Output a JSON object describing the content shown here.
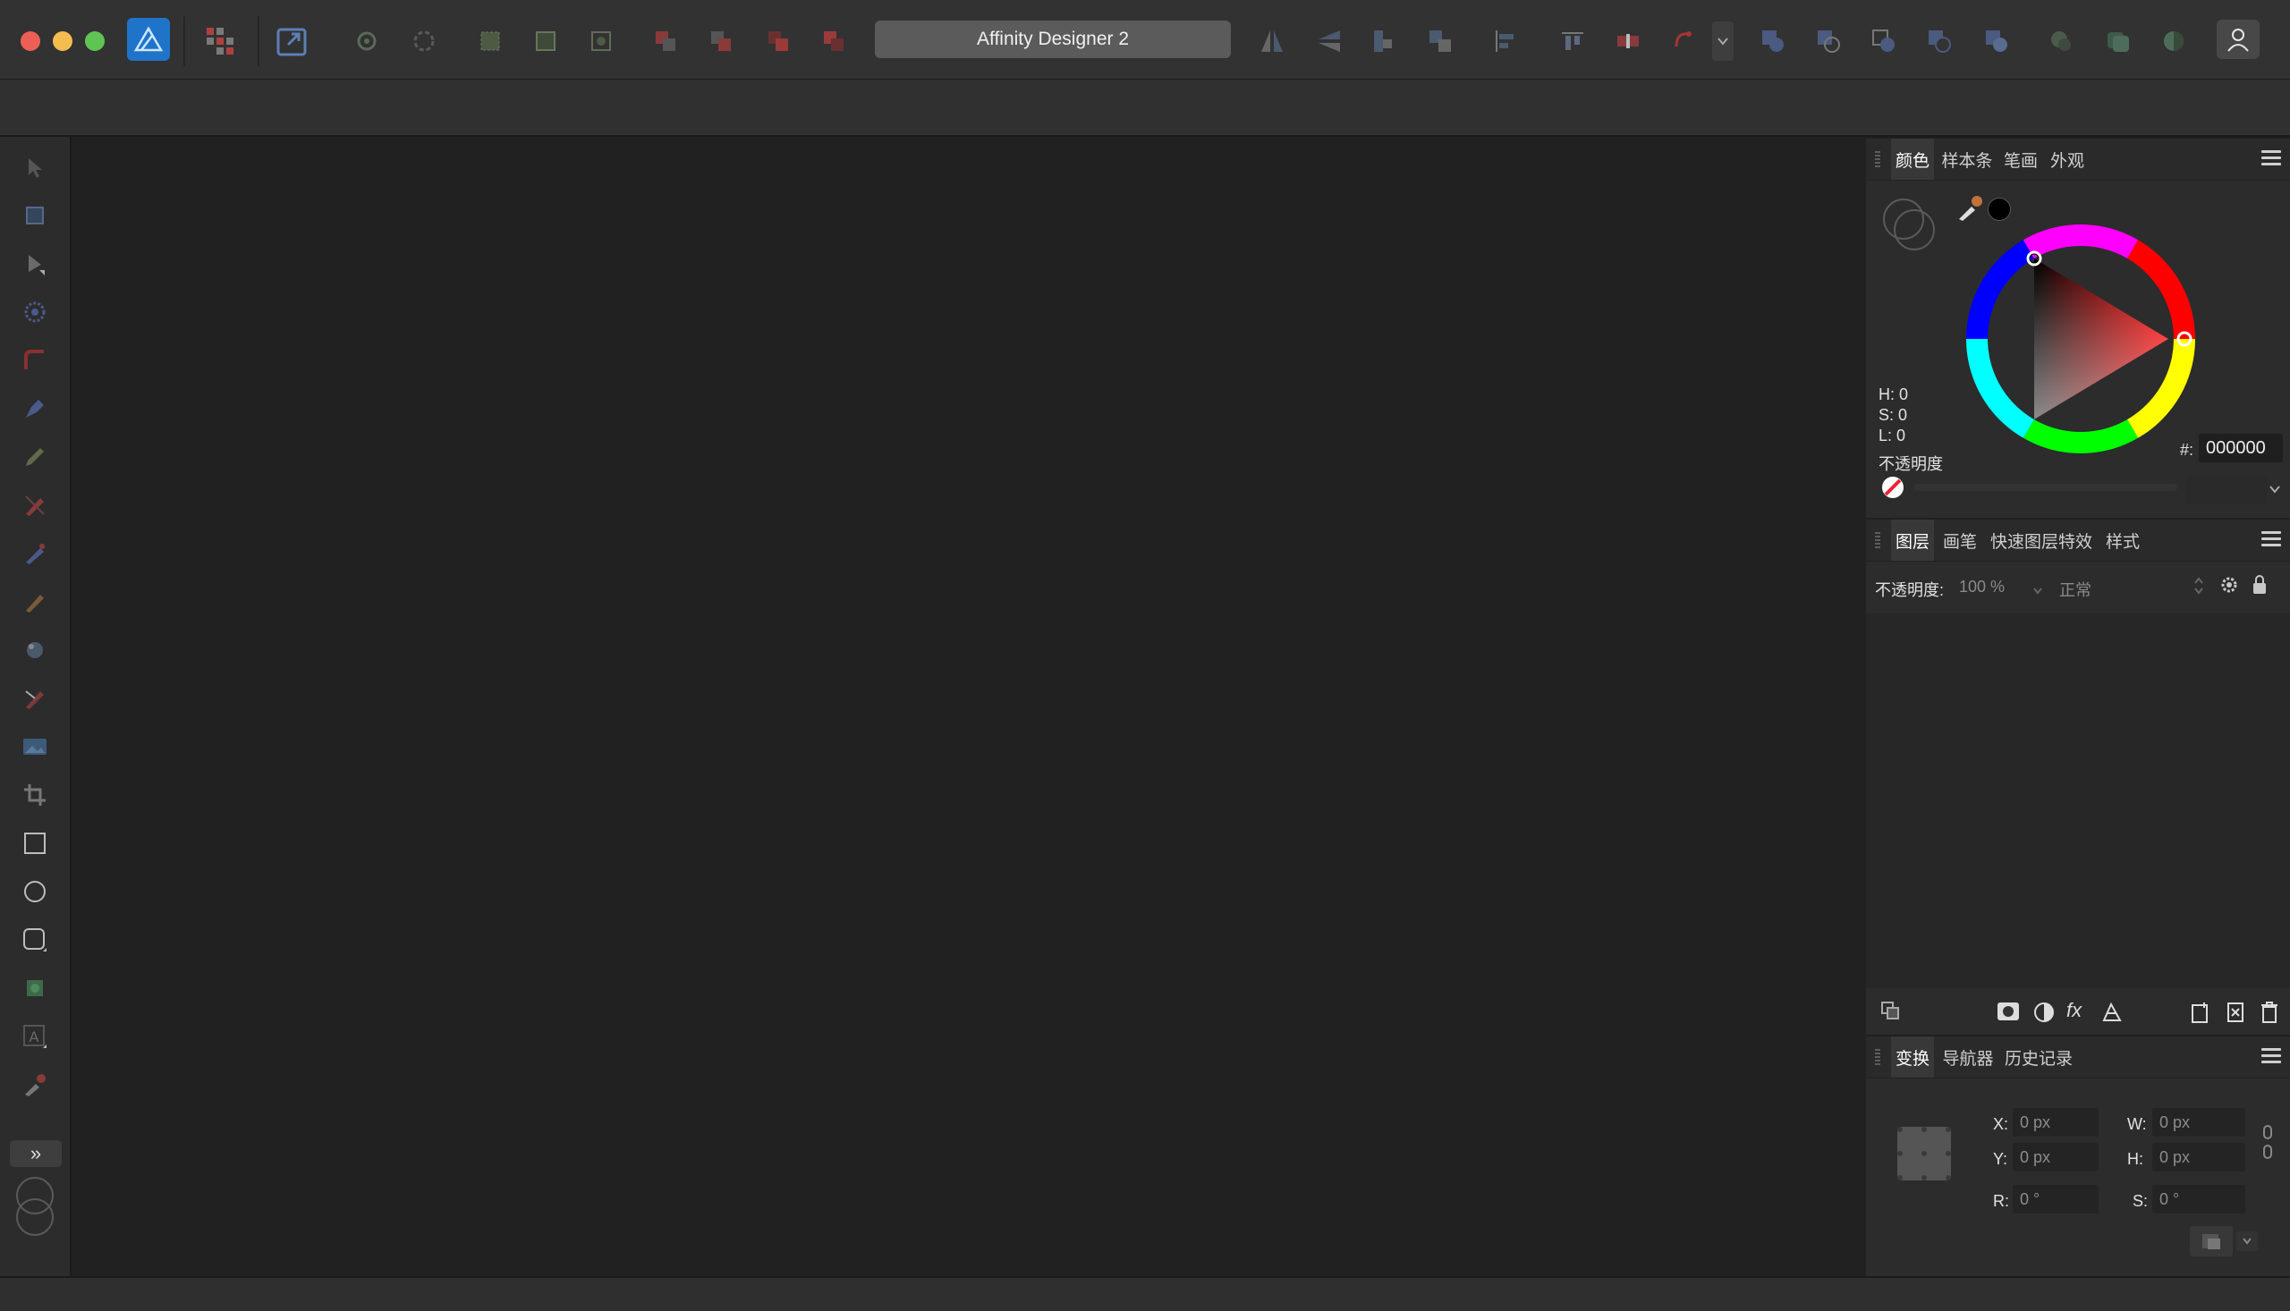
{
  "window": {
    "title": "Affinity Designer 2"
  },
  "toolbar": {
    "icons": [
      "personas-icon",
      "grid-apps-icon",
      "export-persona-icon",
      "snapping-icon",
      "snapping-options-icon",
      "align-bbox-icon",
      "align-geometry-icon",
      "align-pixel-icon",
      "order-back-icon",
      "order-backward-icon",
      "order-forward-icon",
      "order-front-icon",
      "flip-horizontal-icon",
      "flip-vertical-icon",
      "rotate-ccw-icon",
      "rotate-cw-icon",
      "align-icon",
      "distribute-icon",
      "insert-icon",
      "convert-icon",
      "boolean-add-icon",
      "boolean-subtract-icon",
      "boolean-intersect-icon",
      "boolean-xor-icon",
      "boolean-divide-icon",
      "geometry-icon",
      "quick-fx-icon",
      "color-icon",
      "account-icon"
    ]
  },
  "tools": {
    "items": [
      "move-tool",
      "artboard-tool",
      "node-tool",
      "point-transform-tool",
      "corner-tool",
      "pen-tool",
      "pencil-tool",
      "vector-brush-tool",
      "fill-tool",
      "transparency-tool",
      "paint-brush-tool",
      "vector-crop-tool",
      "place-image-tool",
      "crop-tool",
      "rectangle-tool",
      "ellipse-tool",
      "rounded-rect-tool",
      "shape-tool",
      "text-tool",
      "eyedropper-tool"
    ],
    "expand_label": "»"
  },
  "color_panel": {
    "tabs": [
      "颜色",
      "样本条",
      "笔画",
      "外观"
    ],
    "active_tab": 0,
    "h_label": "H: 0",
    "s_label": "S: 0",
    "l_label": "L: 0",
    "opacity_label": "不透明度",
    "hex_label": "#:",
    "hex_value": "000000",
    "current_color": "#000000"
  },
  "layers_panel": {
    "tabs": [
      "图层",
      "画笔",
      "快速图层特效",
      "样式"
    ],
    "active_tab": 0,
    "opacity_label": "不透明度:",
    "opacity_value": "100 %",
    "blend_mode": "正常"
  },
  "transform_panel": {
    "tabs": [
      "变换",
      "导航器",
      "历史记录"
    ],
    "active_tab": 0,
    "x_label": "X:",
    "x_value": "0 px",
    "y_label": "Y:",
    "y_value": "0 px",
    "w_label": "W:",
    "w_value": "0 px",
    "h_label": "H:",
    "h_value": "0 px",
    "r_label": "R:",
    "r_value": "0 °",
    "s_label": "S:",
    "s_value": "0 °"
  },
  "colors": {
    "toolbar_bg": "#323232",
    "canvas_bg": "#212121",
    "panel_bg": "#2c2c2c",
    "accent_blue": "#3a8fd9"
  }
}
